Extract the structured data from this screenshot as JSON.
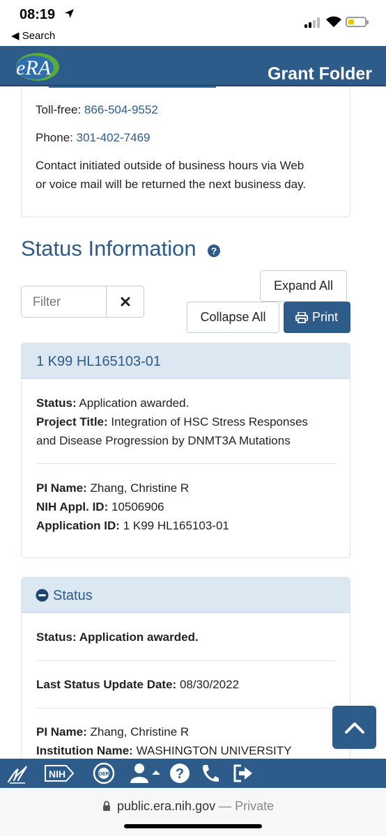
{
  "status_bar": {
    "time": "08:19",
    "back_label": "◀ Search"
  },
  "header": {
    "logo_text": "eRA",
    "title": "Grant Folder"
  },
  "contact": {
    "tollfree_label": "Toll-free:",
    "tollfree_number": "866-504-9552",
    "phone_label": "Phone:",
    "phone_number": "301-402-7469",
    "note_line1": "Contact initiated outside of business hours via Web",
    "note_line2": "or voice mail will be returned the next business day."
  },
  "status_information": {
    "title": "Status Information",
    "filter_placeholder": "Filter",
    "expand_all": "Expand All",
    "collapse_all": "Collapse All",
    "print": "Print"
  },
  "application_panel": {
    "header": "1 K99 HL165103-01",
    "status_label": "Status:",
    "status_value": "Application awarded.",
    "project_title_label": "Project Title:",
    "project_title_line1": "Integration of HSC Stress Responses",
    "project_title_line2": "and Disease Progression by DNMT3A Mutations",
    "pi_label": "PI Name:",
    "pi_value": "Zhang, Christine R",
    "nih_appl_label": "NIH Appl. ID:",
    "nih_appl_value": "10506906",
    "app_id_label": "Application ID:",
    "app_id_value": "1 K99 HL165103-01"
  },
  "status_panel": {
    "header": "Status",
    "status_text": "Status: Application awarded.",
    "last_update_label": "Last Status Update Date:",
    "last_update_value": "08/30/2022",
    "pi_label": "PI Name:",
    "pi_value": "Zhang, Christine R",
    "institution_label": "Institution Name:",
    "institution_value": "WASHINGTON UNIVERSITY"
  },
  "bottom_nav": {
    "nih_label": "NIH",
    "oer_label": "OER"
  },
  "address_bar": {
    "domain": "public.era.nih.gov",
    "privacy": " — Private"
  },
  "colors": {
    "primary": "#2d5b8a",
    "panel_header_bg": "#dbe7f1"
  }
}
